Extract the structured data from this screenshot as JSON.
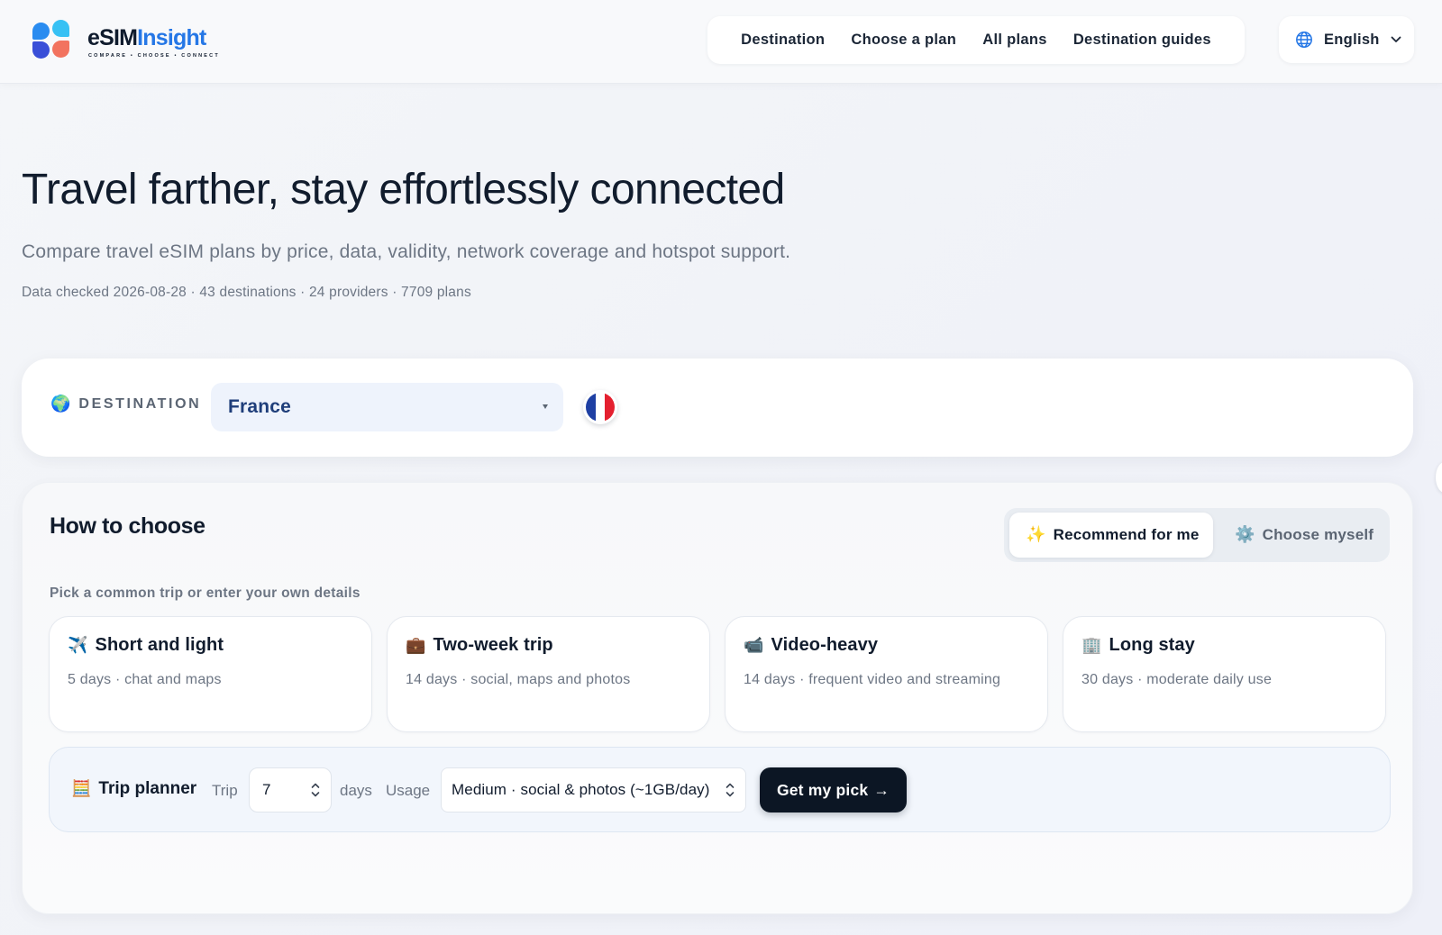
{
  "header": {
    "logo": {
      "word_main": "eSIM",
      "word_accent": "Insight",
      "tagline": "COMPARE • CHOOSE • CONNECT",
      "mark_colors": [
        "#2a8cf0",
        "#37c1f4",
        "#3a4fd8",
        "#f2735f"
      ]
    },
    "nav": [
      {
        "label": "Destination"
      },
      {
        "label": "Choose a plan"
      },
      {
        "label": "All plans"
      },
      {
        "label": "Destination guides"
      }
    ],
    "language": {
      "label": "English",
      "icon": "globe-icon"
    }
  },
  "hero": {
    "title": "Travel farther, stay effortlessly connected",
    "subtitle": "Compare travel eSIM plans by price, data, validity, network coverage and hotspot support.",
    "meta": "Data checked 2026-08-28 · 43 destinations · 24 providers · 7709 plans"
  },
  "destination": {
    "label": "DESTINATION",
    "icon": "🌍",
    "selected": "France",
    "flag_colors": [
      "#1e3fa3",
      "#ffffff",
      "#e4202f"
    ]
  },
  "choose": {
    "title": "How to choose",
    "modes": [
      {
        "icon": "✨",
        "label": "Recommend for me",
        "active": true
      },
      {
        "icon": "⚙️",
        "label": "Choose myself",
        "active": false
      }
    ],
    "hint": "Pick a common trip or enter your own details",
    "trips": [
      {
        "icon": "✈️",
        "title": "Short and light",
        "desc": "5 days · chat and maps"
      },
      {
        "icon": "💼",
        "title": "Two-week trip",
        "desc": "14 days · social, maps and photos"
      },
      {
        "icon": "📹",
        "title": "Video-heavy",
        "desc": "14 days · frequent video and streaming"
      },
      {
        "icon": "🏢",
        "title": "Long stay",
        "desc": "30 days · moderate daily use"
      }
    ],
    "planner": {
      "icon": "🧮",
      "label": "Trip planner",
      "trip_label": "Trip",
      "days_value": "7",
      "days_unit": "days",
      "usage_label": "Usage",
      "usage_value": "Medium · social & photos (~1GB/day)",
      "cta_label": "Get my pick",
      "cta_arrow": "→"
    }
  },
  "colors": {
    "accent": "#2577e6",
    "dark": "#0c1624",
    "muted": "#6d7684"
  }
}
